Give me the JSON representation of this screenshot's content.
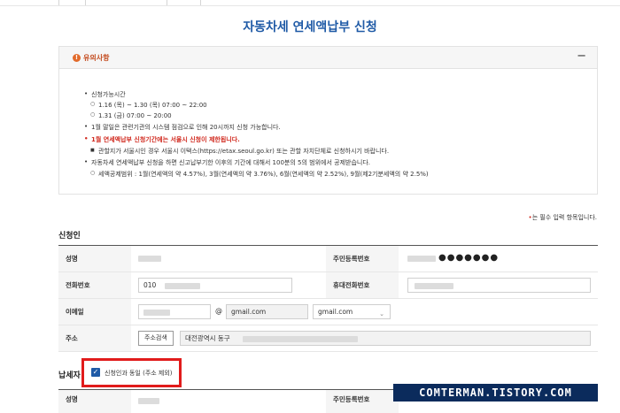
{
  "page_title": "자동차세 연세액납부 신청",
  "notice": {
    "header": "유의사항",
    "toggle": "−",
    "items": {
      "period_label": "신청가능시간",
      "period_1": "1.16 (목) ~ 1.30 (목) 07:00 ~ 22:00",
      "period_2": "1.31 (금) 07:00 ~ 20:00",
      "last_day": "1월 말일은 관련기관의 시스템 점검으로 인해 20시까지 신청 가능합니다.",
      "seoul_warning": "1월 연세액납부 신청기간에는 서울시 신청이 제한됩니다.",
      "seoul_detail": "관할지가 서울시인 경우 서울시 이택스(https://etax.seoul.go.kr) 또는 관할 자치단체로 신청하시기 바랍니다.",
      "deduction": "자동차세 연세액납부 신청을 하면 신고납부기한 이후의 기간에 대해서 100분의 5의 범위에서 공제받습니다.",
      "deduction_detail": "세액공제범위 : 1월(연세액의 약 4.57%), 3월(연세액의 약 3.76%), 6월(연세액의 약 2.52%), 9월(제2기분세액의 약 2.5%)"
    }
  },
  "required_note": {
    "dot": "•",
    "text": "는 필수 입력 항목입니다."
  },
  "applicant": {
    "section_title": "신청인",
    "name_label": "성명",
    "rrn_label": "주민등록번호",
    "rrn_mask": "●●●●●●●",
    "phone_label": "전화번호",
    "phone_value": "010",
    "mobile_label": "휴대전화번호",
    "email_label": "이메일",
    "email_at": "@",
    "email_domain": "gmail.com",
    "email_select": "gmail.com",
    "address_label": "주소",
    "address_button": "주소검색",
    "address_value": "대전광역시 동구"
  },
  "taxpayer": {
    "section_title": "납세자",
    "same_checkbox_label": "신청인과 동일 (주소 제외)",
    "name_label": "성명",
    "rrn_label": "주민등록번호"
  },
  "watermark": "COMTERMAN.TISTORY.COM",
  "colors": {
    "title_blue": "#1f5aa6",
    "highlight_red": "#e11b1b",
    "warning_orange": "#e26b2c"
  }
}
